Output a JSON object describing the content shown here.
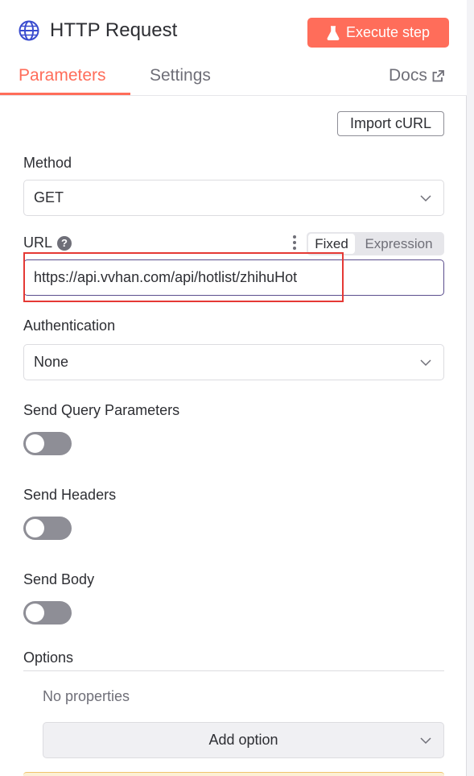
{
  "header": {
    "title": "HTTP Request",
    "execute_label": "Execute step",
    "icon": "globe-icon",
    "accent_color": "#ff6d5a"
  },
  "tabs": {
    "parameters": "Parameters",
    "settings": "Settings",
    "docs": "Docs"
  },
  "import_curl_label": "Import cURL",
  "method": {
    "label": "Method",
    "value": "GET"
  },
  "url": {
    "label": "URL",
    "help_icon": "?",
    "mode_fixed": "Fixed",
    "mode_expression": "Expression",
    "value": "https://api.vvhan.com/api/hotlist/zhihuHot"
  },
  "authentication": {
    "label": "Authentication",
    "value": "None"
  },
  "toggles": {
    "send_query_parameters": {
      "label": "Send Query Parameters",
      "enabled": false
    },
    "send_headers": {
      "label": "Send Headers",
      "enabled": false
    },
    "send_body": {
      "label": "Send Body",
      "enabled": false
    }
  },
  "options": {
    "label": "Options",
    "empty_text": "No properties",
    "add_label": "Add option"
  }
}
